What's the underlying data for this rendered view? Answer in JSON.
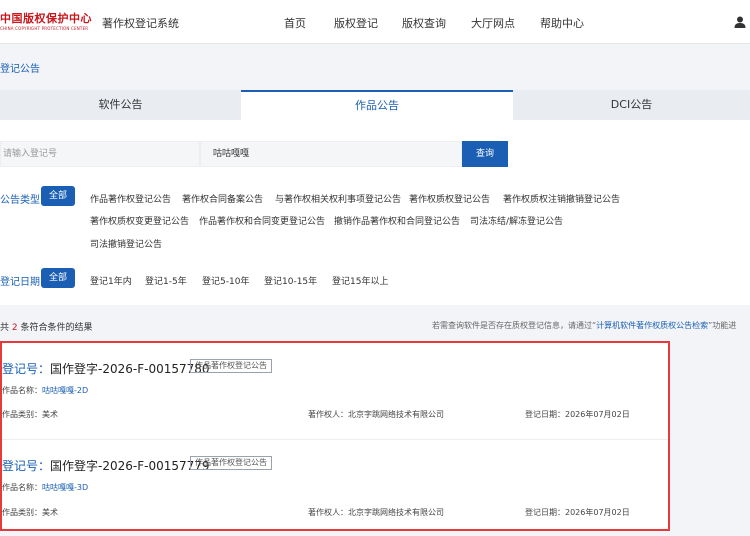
{
  "header": {
    "logo_cn": "中国版权保护中心",
    "logo_en": "CHINA COPYRIGHT PROTECTION CENTER",
    "system_title": "著作权登记系统",
    "nav": [
      "首页",
      "版权登记",
      "版权查询",
      "大厅网点",
      "帮助中心"
    ]
  },
  "breadcrumb": "登记公告",
  "tabs": [
    "软件公告",
    "作品公告",
    "DCI公告"
  ],
  "active_tab": 1,
  "search": {
    "reg_placeholder": "请输入登记号",
    "keyword": "咕咕嘎嘎",
    "button": "查询"
  },
  "filters": {
    "type_label": "公告类型：",
    "type_all": "全部",
    "type_options": [
      "作品著作权登记公告",
      "著作权合同备案公告",
      "与著作权相关权利事项登记公告",
      "著作权质权登记公告",
      "著作权质权注销撤销登记公告",
      "著作权质权变更登记公告",
      "作品著作权和合同变更登记公告",
      "撤销作品著作权和合同登记公告",
      "司法冻结/解冻登记公告",
      "司法撤销登记公告"
    ],
    "date_label": "登记日期：",
    "date_all": "全部",
    "date_options": [
      "登记1年内",
      "登记1-5年",
      "登记5-10年",
      "登记10-15年",
      "登记15年以上"
    ]
  },
  "count": {
    "prefix": "共",
    "num": "2",
    "suffix": "条符合条件的结果"
  },
  "tip": {
    "text1": "若需查询软件是否存在质权登记信息，请通过“",
    "link": "计算机软件著作权质权公告检索",
    "text2": "”功能进"
  },
  "results": [
    {
      "key": "登记号：",
      "number": "国作登字-2026-F-00157780",
      "tag": "作品著作权登记公告",
      "name_label": "作品名称：",
      "name": "咕咕嘎嘎-2D",
      "cat_label": "作品类别：",
      "category": "美术",
      "owner_label": "著作权人：",
      "owner": "北京字跳网络技术有限公司",
      "date_label": "登记日期：",
      "date": "2026年07月02日"
    },
    {
      "key": "登记号：",
      "number": "国作登字-2026-F-00157779",
      "tag": "作品著作权登记公告",
      "name_label": "作品名称：",
      "name": "咕咕嘎嘎-3D",
      "cat_label": "作品类别：",
      "category": "美术",
      "owner_label": "著作权人：",
      "owner": "北京字跳网络技术有限公司",
      "date_label": "登记日期：",
      "date": "2026年07月02日"
    }
  ],
  "colors": {
    "primary": "#1a5fb4",
    "brand_red": "#c8161d",
    "highlight_border": "#e8393b"
  },
  "icons": {
    "user": "user-icon"
  }
}
